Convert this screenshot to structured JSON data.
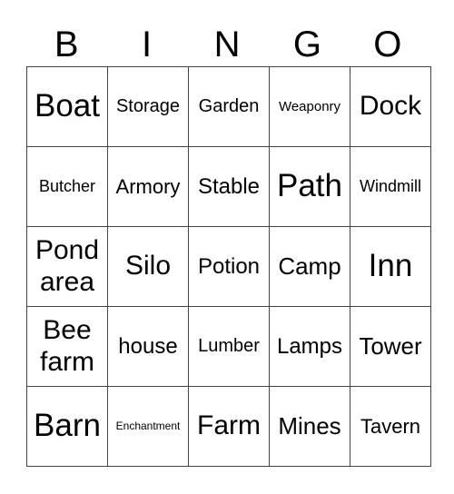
{
  "header": [
    "B",
    "I",
    "N",
    "G",
    "O"
  ],
  "rows": [
    [
      "Boat",
      "Storage",
      "Garden",
      "Weaponry",
      "Dock"
    ],
    [
      "Butcher",
      "Armory",
      "Stable",
      "Path",
      "Windmill"
    ],
    [
      "Pond area",
      "Silo",
      "Potion",
      "Camp",
      "Inn"
    ],
    [
      "Bee farm",
      "house",
      "Lumber",
      "Lamps",
      "Tower"
    ],
    [
      "Barn",
      "Enchantment",
      "Farm",
      "Mines",
      "Tavern"
    ]
  ]
}
